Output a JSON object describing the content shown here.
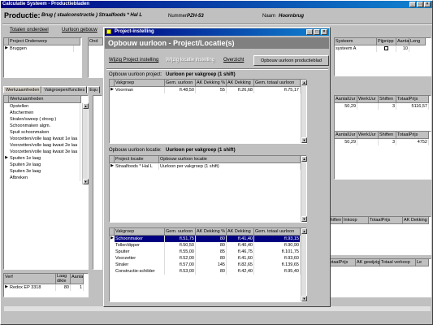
{
  "app": {
    "title": "Calculatie Systeem - Productiebladen"
  },
  "main_header": {
    "productie_label": "Productie:",
    "productie_value": "Brug ( staalconstructie ) Straalfoods * Hal L",
    "nummer_label": "Nummer",
    "nummer_value": "PZH-53",
    "naam_label": "Naam",
    "naam_value": "Hoornbrug"
  },
  "toolbar": {
    "totalen_label": "Totalen onderdeel",
    "uurloon_label": "Uurloon gebouw"
  },
  "project_onderwerp": {
    "header": "Project Onderwerp",
    "rows": [
      "Bruggen"
    ]
  },
  "bg_grid1": {
    "headers": [
      "Ond",
      "Werk"
    ]
  },
  "right_top_grid": {
    "headers": [
      "Systeem",
      "Pijpnipp",
      "Aantal",
      "Leng"
    ],
    "row": [
      "systeem A",
      "",
      "10",
      ""
    ]
  },
  "tabs": [
    "Werkzaamheden",
    "Vakgroepen/functies",
    "Equ"
  ],
  "werkzaamheden": {
    "header": "Werkzaamheden",
    "rows": [
      "Opstellen",
      "Afschermen",
      "Stralen/sweep ( droog )",
      "Schoonmaken algm.",
      "Spuit schoonmaken",
      "Voorzetten/volle laag kwast 1e laa",
      "Voorzetten/volle laag kwast 2e laa",
      "Voorzetten/volle laag kwast 3e laa",
      "Spuiten 1e laag",
      "Spuiten 2e laag",
      "Spuiten 3e laag",
      "Afbreken"
    ]
  },
  "verf_grid": {
    "headers": [
      "Verf",
      "Laag dikte",
      "Aantal"
    ],
    "row": [
      "Redox EP 3318",
      "80",
      "1"
    ]
  },
  "right_mid_grid": {
    "headers": [
      "AantalUur",
      "WerkUur",
      "Shiften",
      "TotaalPrijs"
    ],
    "rows": [
      [
        "50,29",
        "",
        "3",
        "5116,57"
      ],
      [
        "50,29",
        "",
        "3",
        "4752"
      ]
    ]
  },
  "right_low_grid": {
    "headers": [
      "Shiften",
      "Inkoop",
      "TotaalPrijs",
      "AK Dekking"
    ]
  },
  "right_bottom_grid": {
    "headers": [
      "TotaalPrijs",
      "AK gewijzigd",
      "Totaal verkoop",
      "Le"
    ]
  },
  "dialog": {
    "title": "Project-instelling",
    "heading": "Opbouw uurloon - Project/Locatie(s)",
    "menu": {
      "wijzig": "Wijzig Project instelling",
      "wijzig_locatie": "Wijzig locatie instelling",
      "overzicht": "Overzicht",
      "button": "Opbouw uurloon productieblad"
    },
    "section1": {
      "prefix": "Opbouw uurloon project:",
      "bold": "Uurloon per vakgroep (1 shift)",
      "headers": [
        "Vakgroep",
        "Gem. uurloon",
        "AK Dekking %",
        "AK Dekking",
        "Gem. totaal uurloon"
      ],
      "rows": [
        [
          "Voorman",
          "fl.48,50",
          "55",
          "fl.26,68",
          "fl.75,17"
        ]
      ]
    },
    "section2": {
      "prefix": "Opbouw uurloon locatie:",
      "bold": "Uurloon per vakgroep (1 shift)",
      "headers": [
        "Project locatie",
        "Opbouw uurloon locatie"
      ],
      "rows": [
        [
          "Straalfoods * Hal L",
          "Uurloon per vakgroep (1 shift)"
        ]
      ]
    },
    "section3": {
      "headers": [
        "Vakgroep",
        "Gem. uurloon",
        "AK Dekking %",
        "AK Dekking",
        "Gem. totaal uurloon"
      ],
      "rows": [
        [
          "Schoonmaker",
          "fl.51,75",
          "80",
          "fl.41,40",
          "fl.93,15"
        ],
        [
          "Toller/dipper",
          "fl.50,50",
          "80",
          "fl.40,40",
          "fl.90,90"
        ],
        [
          "Spuiter",
          "fl.55,00",
          "85",
          "fl.46,75",
          "fl.101,75"
        ],
        [
          "Voorzetter",
          "fl.52,00",
          "80",
          "fl.41,60",
          "fl.93,60"
        ],
        [
          "Straler",
          "fl.57,00",
          "145",
          "fl.82,65",
          "fl.139,65"
        ],
        [
          "Constructie-schilder",
          "fl.53,00",
          "80",
          "fl.42,40",
          "fl.95,40"
        ]
      ]
    }
  }
}
